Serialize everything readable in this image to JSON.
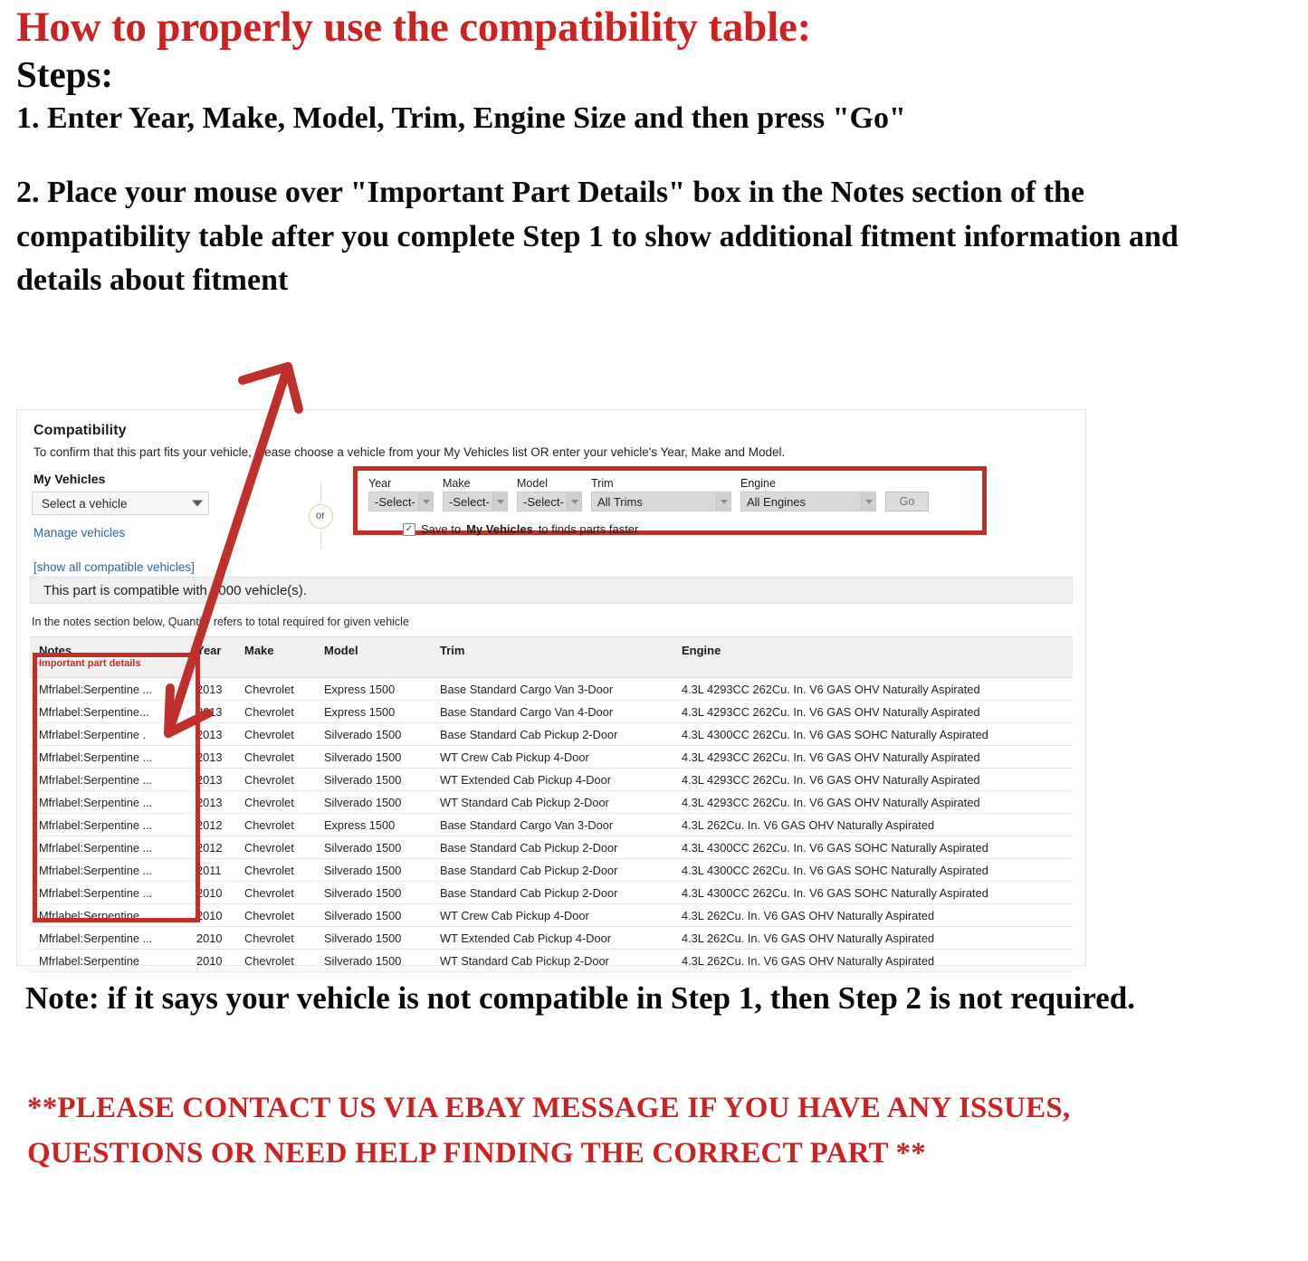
{
  "heading": {
    "title": "How to properly use the compatibility table:",
    "steps_label": "Steps:",
    "step1": "1. Enter Year, Make, Model, Trim, Engine Size and then press \"Go\"",
    "step2": "2. Place your mouse over \"Important Part Details\" box in the Notes section of the compatibility table after you complete Step 1 to show additional fitment information and details about fitment"
  },
  "footer": {
    "note": "Note: if it says your vehicle is not compatible in Step 1, then Step 2 is not required.",
    "contact": "**PLEASE CONTACT US VIA EBAY MESSAGE IF YOU HAVE ANY ISSUES, QUESTIONS OR NEED HELP FINDING THE CORRECT PART **"
  },
  "colors": {
    "title_red": "#cc2222",
    "highlight_red": "#c0302a",
    "link_blue": "#3162a8",
    "header_grey": "#f0f0f0"
  },
  "panel": {
    "title": "Compatibility",
    "subtitle": "To confirm that this part fits your vehicle, please choose a vehicle from your My Vehicles list OR enter your vehicle's Year, Make and Model.",
    "my_vehicles": {
      "label": "My Vehicles",
      "select_value": "Select a vehicle",
      "manage_link": "Manage vehicles",
      "show_all_link": "[show all compatible vehicles]"
    },
    "or_divider": "or",
    "ymm_form": {
      "fields": [
        {
          "label": "Year",
          "value": "-Select-"
        },
        {
          "label": "Make",
          "value": "-Select-"
        },
        {
          "label": "Model",
          "value": "-Select-"
        },
        {
          "label": "Trim",
          "value": "All Trims"
        },
        {
          "label": "Engine",
          "value": "All Engines"
        }
      ],
      "go_label": "Go",
      "save_checkbox": {
        "checked": true,
        "check_glyph": "✓",
        "text_before": "Save to",
        "text_bold": "My Vehicles",
        "text_after": "to finds parts faster"
      }
    },
    "compat_banner": "This part is compatible with 1000 vehicle(s).",
    "notes_hint": "In the notes section below, Quantity refers to total required for given vehicle",
    "table": {
      "columns": [
        "Notes",
        "Year",
        "Make",
        "Model",
        "Trim",
        "Engine"
      ],
      "notes_subheader": "Important part details",
      "rows": [
        {
          "notes": "Mfrlabel:Serpentine ...",
          "year": "2013",
          "make": "Chevrolet",
          "model": "Express 1500",
          "trim": "Base Standard Cargo Van 3-Door",
          "engine": "4.3L 4293CC 262Cu. In. V6 GAS OHV Naturally Aspirated"
        },
        {
          "notes": "Mfrlabel:Serpentine...",
          "year": "2013",
          "make": "Chevrolet",
          "model": "Express 1500",
          "trim": "Base Standard Cargo Van 4-Door",
          "engine": "4.3L 4293CC 262Cu. In. V6 GAS OHV Naturally Aspirated"
        },
        {
          "notes": "Mfrlabel:Serpentine .",
          "year": "2013",
          "make": "Chevrolet",
          "model": "Silverado 1500",
          "trim": "Base Standard Cab Pickup 2-Door",
          "engine": "4.3L 4300CC 262Cu. In. V6 GAS SOHC Naturally Aspirated"
        },
        {
          "notes": "Mfrlabel:Serpentine ...",
          "year": "2013",
          "make": "Chevrolet",
          "model": "Silverado 1500",
          "trim": "WT Crew Cab Pickup 4-Door",
          "engine": "4.3L 4293CC 262Cu. In. V6 GAS OHV Naturally Aspirated"
        },
        {
          "notes": "Mfrlabel:Serpentine ...",
          "year": "2013",
          "make": "Chevrolet",
          "model": "Silverado 1500",
          "trim": "WT Extended Cab Pickup 4-Door",
          "engine": "4.3L 4293CC 262Cu. In. V6 GAS OHV Naturally Aspirated"
        },
        {
          "notes": "Mfrlabel:Serpentine ...",
          "year": "2013",
          "make": "Chevrolet",
          "model": "Silverado 1500",
          "trim": "WT Standard Cab Pickup 2-Door",
          "engine": "4.3L 4293CC 262Cu. In. V6 GAS OHV Naturally Aspirated"
        },
        {
          "notes": "Mfrlabel:Serpentine ...",
          "year": "2012",
          "make": "Chevrolet",
          "model": "Express 1500",
          "trim": "Base Standard Cargo Van 3-Door",
          "engine": "4.3L 262Cu. In. V6 GAS OHV Naturally Aspirated"
        },
        {
          "notes": "Mfrlabel:Serpentine ...",
          "year": "2012",
          "make": "Chevrolet",
          "model": "Silverado 1500",
          "trim": "Base Standard Cab Pickup 2-Door",
          "engine": "4.3L 4300CC 262Cu. In. V6 GAS SOHC Naturally Aspirated"
        },
        {
          "notes": "Mfrlabel:Serpentine ...",
          "year": "2011",
          "make": "Chevrolet",
          "model": "Silverado 1500",
          "trim": "Base Standard Cab Pickup 2-Door",
          "engine": "4.3L 4300CC 262Cu. In. V6 GAS SOHC Naturally Aspirated"
        },
        {
          "notes": "Mfrlabel:Serpentine ...",
          "year": "2010",
          "make": "Chevrolet",
          "model": "Silverado 1500",
          "trim": "Base Standard Cab Pickup 2-Door",
          "engine": "4.3L 4300CC 262Cu. In. V6 GAS SOHC Naturally Aspirated"
        },
        {
          "notes": "Mfrlabel:Serpentine ...",
          "year": "2010",
          "make": "Chevrolet",
          "model": "Silverado 1500",
          "trim": "WT Crew Cab Pickup 4-Door",
          "engine": "4.3L 262Cu. In. V6 GAS OHV Naturally Aspirated"
        },
        {
          "notes": "Mfrlabel:Serpentine ...",
          "year": "2010",
          "make": "Chevrolet",
          "model": "Silverado 1500",
          "trim": "WT Extended Cab Pickup 4-Door",
          "engine": "4.3L 262Cu. In. V6 GAS OHV Naturally Aspirated"
        },
        {
          "notes": "Mfrlabel:Serpentine",
          "year": "2010",
          "make": "Chevrolet",
          "model": "Silverado 1500",
          "trim": "WT Standard Cab Pickup 2-Door",
          "engine": "4.3L 262Cu. In. V6 GAS OHV Naturally Aspirated"
        }
      ]
    }
  }
}
